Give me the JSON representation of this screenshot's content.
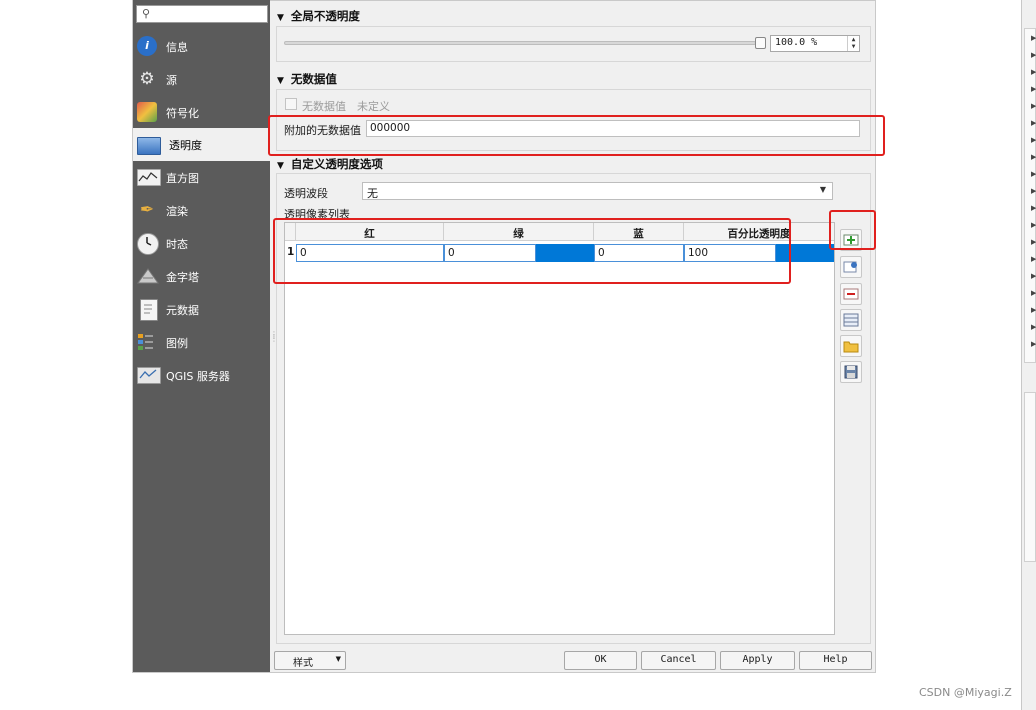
{
  "sidebar": {
    "search_icon": "search-icon",
    "items": [
      {
        "label": "信息",
        "icon": "info-icon",
        "color": "#2a6fc9"
      },
      {
        "label": "源",
        "icon": "gear-icon",
        "color": "#dddddd"
      },
      {
        "label": "符号化",
        "icon": "paint-icon",
        "color": "#e0a040"
      },
      {
        "label": "透明度",
        "icon": "transparency-icon",
        "color": "#4a80c8"
      },
      {
        "label": "直方图",
        "icon": "histogram-icon",
        "color": "#eeeeee"
      },
      {
        "label": "渲染",
        "icon": "brush-icon",
        "color": "#e8b040"
      },
      {
        "label": "时态",
        "icon": "clock-icon",
        "color": "#eeeeee"
      },
      {
        "label": "金字塔",
        "icon": "pyramid-icon",
        "color": "#aaaaaa"
      },
      {
        "label": "元数据",
        "icon": "document-icon",
        "color": "#f0f0f0"
      },
      {
        "label": "图例",
        "icon": "legend-icon",
        "color": "#e8a020"
      },
      {
        "label": "QGIS 服务器",
        "icon": "server-icon",
        "color": "#e6e6e6"
      }
    ],
    "active_index": 3
  },
  "global_opacity": {
    "title": "全局不透明度",
    "value_text": "100.0 %"
  },
  "nodata": {
    "title": "无数据值",
    "checkbox_label": "无数据值",
    "checkbox_value": "未定义",
    "additional_label": "附加的无数据值",
    "additional_value": "000000"
  },
  "custom": {
    "title": "自定义透明度选项",
    "band_label": "透明波段",
    "band_value": "无",
    "list_label": "透明像素列表",
    "columns": [
      "红",
      "绿",
      "蓝",
      "百分比透明度"
    ],
    "rows": [
      {
        "index": "1",
        "red": "0",
        "green": "0",
        "blue": "0",
        "percent": "100"
      }
    ]
  },
  "tools": [
    "add-row-icon",
    "pick-from-canvas-icon",
    "remove-row-icon",
    "default-values-icon",
    "import-file-icon",
    "export-file-icon"
  ],
  "footer": {
    "style_label": "样式",
    "ok": "OK",
    "cancel": "Cancel",
    "apply": "Apply",
    "help": "Help"
  },
  "watermark": "CSDN @Miyagi.Z",
  "colors": {
    "annotation": "#e0201e",
    "selection": "#0078d7",
    "sidebar_bg": "#5b5b5b"
  }
}
